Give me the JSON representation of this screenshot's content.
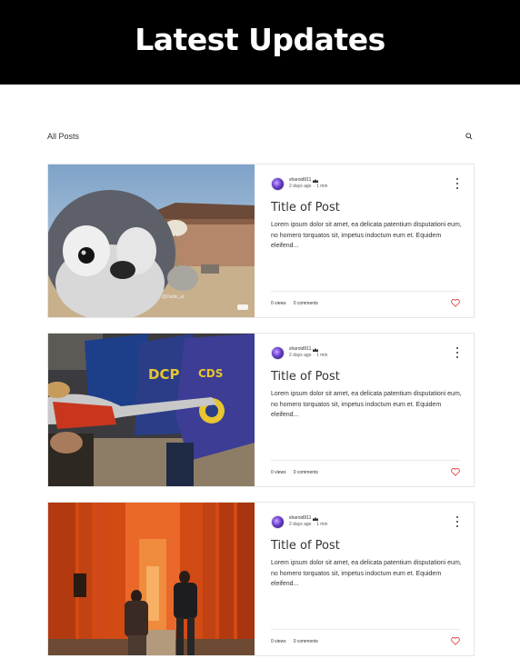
{
  "header": {
    "title": "Latest Updates"
  },
  "filter": {
    "all_posts_label": "All Posts"
  },
  "posts": [
    {
      "author": "sharoid911",
      "date": "2 days ago",
      "read_time": "1 min",
      "title": "Title of Post",
      "excerpt": "Lorem ipsum dolor sit amet, ea delicata patentium disputationi eum, no homero torquatos sit, impetus indoctum eum et. Equidem eleifend...",
      "views": "0 views",
      "comments": "0 comments",
      "image_desc": "baby-penguin-photo",
      "image_watermark": "@Dallin_ai"
    },
    {
      "author": "sharoid911",
      "date": "2 days ago",
      "read_time": "1 min",
      "title": "Title of Post",
      "excerpt": "Lorem ipsum dolor sit amet, ea delicata patentium disputationi eum, no homero torquatos sit, impetus indoctum eum et. Equidem eleifend...",
      "views": "0 views",
      "comments": "0 comments",
      "image_desc": "riot-police-shields-photo",
      "shield_text_1": "DCP",
      "shield_text_2": "CDS"
    },
    {
      "author": "sharoid911",
      "date": "2 days ago",
      "read_time": "1 min",
      "title": "Title of Post",
      "excerpt": "Lorem ipsum dolor sit amet, ea delicata patentium disputationi eum, no homero torquatos sit, impetus indoctum eum et. Equidem eleifend...",
      "views": "0 views",
      "comments": "0 comments",
      "image_desc": "torii-gates-path-photo"
    }
  ],
  "colors": {
    "heart": "#e4504d",
    "header_bg": "#000000"
  },
  "icons": {
    "search": "search-icon",
    "more": "more-vertical-icon",
    "like": "heart-icon",
    "crown": "crown-icon"
  }
}
